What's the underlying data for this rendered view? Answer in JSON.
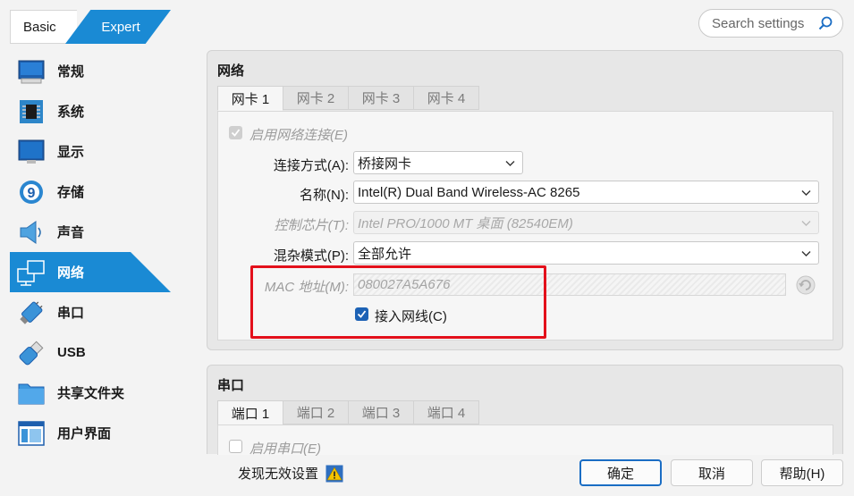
{
  "mode": {
    "basic": "Basic",
    "expert": "Expert"
  },
  "search": {
    "placeholder": "Search settings"
  },
  "sidebar": {
    "items": [
      {
        "label": "常规",
        "icon": "general-icon"
      },
      {
        "label": "系统",
        "icon": "system-icon"
      },
      {
        "label": "显示",
        "icon": "display-icon"
      },
      {
        "label": "存储",
        "icon": "storage-icon"
      },
      {
        "label": "声音",
        "icon": "audio-icon"
      },
      {
        "label": "网络",
        "icon": "network-icon",
        "active": true
      },
      {
        "label": "串口",
        "icon": "serial-icon"
      },
      {
        "label": "USB",
        "icon": "usb-icon"
      },
      {
        "label": "共享文件夹",
        "icon": "shared-folder-icon"
      },
      {
        "label": "用户界面",
        "icon": "user-interface-icon"
      }
    ]
  },
  "network": {
    "title": "网络",
    "tabs": [
      "网卡 1",
      "网卡 2",
      "网卡 3",
      "网卡 4"
    ],
    "enable_label": "启用网络连接(E)",
    "attached_label": "连接方式(A):",
    "attached_value": "桥接网卡",
    "name_label": "名称(N):",
    "name_value": "Intel(R) Dual Band Wireless-AC 8265",
    "adapter_label": "控制芯片(T):",
    "adapter_value": "Intel PRO/1000 MT 桌面 (82540EM)",
    "promisc_label": "混杂模式(P):",
    "promisc_value": "全部允许",
    "mac_label": "MAC 地址(M):",
    "mac_value": "080027A5A676",
    "cable_label": "接入网线(C)",
    "cable_checked": true
  },
  "serial": {
    "title": "串口",
    "tabs": [
      "端口 1",
      "端口 2",
      "端口 3",
      "端口 4"
    ],
    "enable_label": "启用串口(E)"
  },
  "footer": {
    "warning": "发现无效设置",
    "ok": "确定",
    "cancel": "取消",
    "help": "帮助(H)"
  },
  "colors": {
    "accent": "#1a8ad4",
    "highlight_box": "#e3101b"
  }
}
